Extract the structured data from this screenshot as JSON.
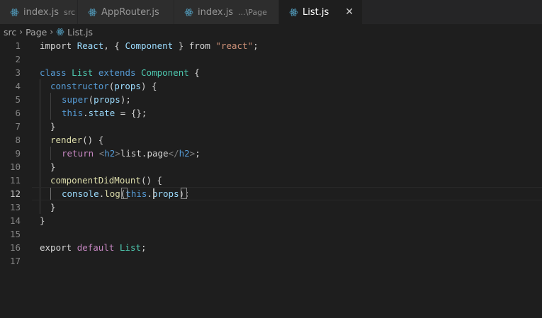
{
  "tabs": [
    {
      "label": "index.js",
      "description": "src",
      "active": false
    },
    {
      "label": "AppRouter.js",
      "description": "",
      "active": false
    },
    {
      "label": "index.js",
      "description": "...\\Page",
      "active": false
    },
    {
      "label": "List.js",
      "description": "",
      "active": true,
      "close": "✕"
    }
  ],
  "breadcrumb": {
    "items": [
      "src",
      "Page",
      "List.js"
    ],
    "separator": "›"
  },
  "editor": {
    "line_numbers": [
      "1",
      "2",
      "3",
      "4",
      "5",
      "6",
      "7",
      "8",
      "9",
      "10",
      "11",
      "12",
      "13",
      "14",
      "15",
      "16",
      "17"
    ],
    "current_line": 12,
    "colors": {
      "keyword": "#c586c0",
      "storage": "#569cd6",
      "class": "#4ec9b0",
      "function": "#dcdcaa",
      "string": "#ce9178",
      "variable": "#9cdcfe",
      "plain": "#d4d4d4"
    },
    "tokens": {
      "l1": [
        "import",
        " ",
        "React",
        ", { ",
        "Component",
        " } ",
        "from",
        " ",
        "\"react\"",
        ";"
      ],
      "l3": [
        "class",
        " ",
        "List",
        " ",
        "extends",
        " ",
        "Component",
        " {"
      ],
      "l4": [
        "constructor",
        "(",
        "props",
        ") {"
      ],
      "l5": [
        "super",
        "(",
        "props",
        ");"
      ],
      "l6": [
        "this",
        ".",
        "state",
        " = {};"
      ],
      "l7": [
        "}"
      ],
      "l8": [
        "render",
        "() {"
      ],
      "l9": [
        "return",
        " ",
        "<",
        "h2",
        ">",
        "list.page",
        "</",
        "h2",
        ">",
        ";"
      ],
      "l10": [
        "}"
      ],
      "l11": [
        "componentDidMount",
        "() {"
      ],
      "l12": [
        "console",
        ".",
        "log",
        "(",
        "this",
        ".",
        "props",
        ")",
        ";"
      ],
      "l13": [
        "}"
      ],
      "l14": [
        "}"
      ],
      "l16": [
        "export",
        " ",
        "default",
        " ",
        "List",
        ";"
      ]
    }
  }
}
